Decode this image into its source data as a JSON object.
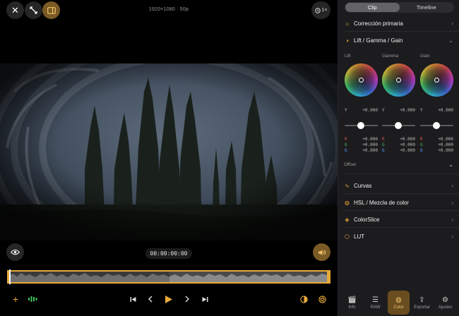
{
  "viewer": {
    "resolution_label": "1920×1080 · 50p",
    "speed_label": "1×",
    "timecode": "00:00:00:00",
    "icons": {
      "close": "close-icon",
      "expand": "expand-icon",
      "panel_toggle": "sidebar-toggle-icon",
      "speed": "timer-icon",
      "visibility": "eye-icon",
      "audio": "speaker-icon"
    }
  },
  "transport": {
    "add": "plus-icon",
    "audio_meter": "audio-meter-icon",
    "skip_start": "skip-to-start-icon",
    "prev_frame": "previous-frame-icon",
    "play": "play-icon",
    "next_frame": "next-frame-icon",
    "skip_end": "skip-to-end-icon",
    "color_mode": "contrast-icon",
    "effects": "aperture-icon"
  },
  "panel": {
    "segments": [
      "Clip",
      "Timeline"
    ],
    "active_segment": "Clip",
    "sections": {
      "primary": "Corrección primaria",
      "lgg": "Lift / Gamma / Gain",
      "offset": "Offset",
      "curves": "Curvas",
      "hsl": "HSL / Mezcla de color",
      "colorslice": "ColorSlice",
      "lut": "LUT"
    },
    "wheels": [
      {
        "title": "Lift",
        "y_label": "Y",
        "y_value": "+0.000",
        "r_label": "R",
        "r": "+0.000",
        "g_label": "G",
        "g": "+0.000",
        "b_label": "B",
        "b": "+0.000"
      },
      {
        "title": "Gamma",
        "y_label": "Y",
        "y_value": "+0.000",
        "r_label": "R",
        "r": "+0.000",
        "g_label": "G",
        "g": "+0.000",
        "b_label": "B",
        "b": "+0.000"
      },
      {
        "title": "Gain",
        "y_label": "Y",
        "y_value": "+0.000",
        "r_label": "R",
        "r": "+0.000",
        "g_label": "G",
        "g": "+0.000",
        "b_label": "B",
        "b": "+0.000"
      }
    ],
    "tabs": [
      {
        "label": "Info",
        "icon": "clapperboard-icon"
      },
      {
        "label": "RAW",
        "icon": "raw-icon"
      },
      {
        "label": "Color",
        "icon": "palette-icon"
      },
      {
        "label": "Exportar",
        "icon": "share-icon"
      },
      {
        "label": "Ajustes",
        "icon": "gear-icon"
      }
    ],
    "active_tab": "Color"
  },
  "colors": {
    "accent": "#e8a93a",
    "panel_bg": "#1c1c1e"
  }
}
